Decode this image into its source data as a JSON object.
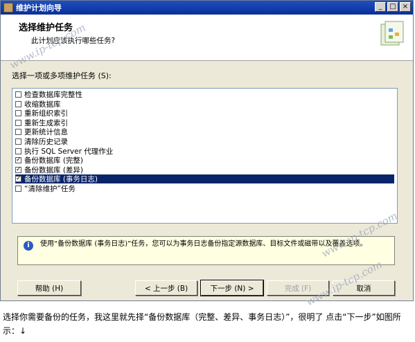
{
  "window": {
    "title": "维护计划向导",
    "buttons": {
      "minimize": "_",
      "maximize": "□",
      "close": "×"
    }
  },
  "header": {
    "title": "选择维护任务",
    "subtitle": "此计划应该执行哪些任务?"
  },
  "list_label": "选择一项或多项维护任务 (S):",
  "tasks": [
    {
      "label": "检查数据库完整性",
      "checked": false,
      "selected": false
    },
    {
      "label": "收缩数据库",
      "checked": false,
      "selected": false
    },
    {
      "label": "重新组织索引",
      "checked": false,
      "selected": false
    },
    {
      "label": "重新生成索引",
      "checked": false,
      "selected": false
    },
    {
      "label": "更新统计信息",
      "checked": false,
      "selected": false
    },
    {
      "label": "清除历史记录",
      "checked": false,
      "selected": false
    },
    {
      "label": "执行 SQL Server 代理作业",
      "checked": false,
      "selected": false
    },
    {
      "label": "备份数据库 (完整)",
      "checked": true,
      "selected": false
    },
    {
      "label": "备份数据库 (差异)",
      "checked": true,
      "selected": false
    },
    {
      "label": "备份数据库 (事务日志)",
      "checked": true,
      "selected": true
    },
    {
      "label": "“清除维护”任务",
      "checked": false,
      "selected": false
    }
  ],
  "info": {
    "icon": "info-icon",
    "text": "使用“备份数据库 (事务日志)”任务，您可以为事务日志备份指定源数据库、目标文件或磁带以及覆盖选项。"
  },
  "buttons": {
    "help": "帮助 (H)",
    "back": "< 上一步 (B)",
    "next": "下一步 (N) >",
    "finish": "完成 (F)",
    "cancel": "取消"
  },
  "caption": "选择你需要备份的任务，我这里就先择“备份数据库（完整、差异、事务日志）”，很明了 点击“下一步”如图所示：↓",
  "watermark": "www.ip-tcp.com",
  "colors": {
    "titlebar": "#0b2f95",
    "selection": "#0a246a",
    "dialog": "#ece9d8",
    "info_bg": "#ffffe1"
  }
}
